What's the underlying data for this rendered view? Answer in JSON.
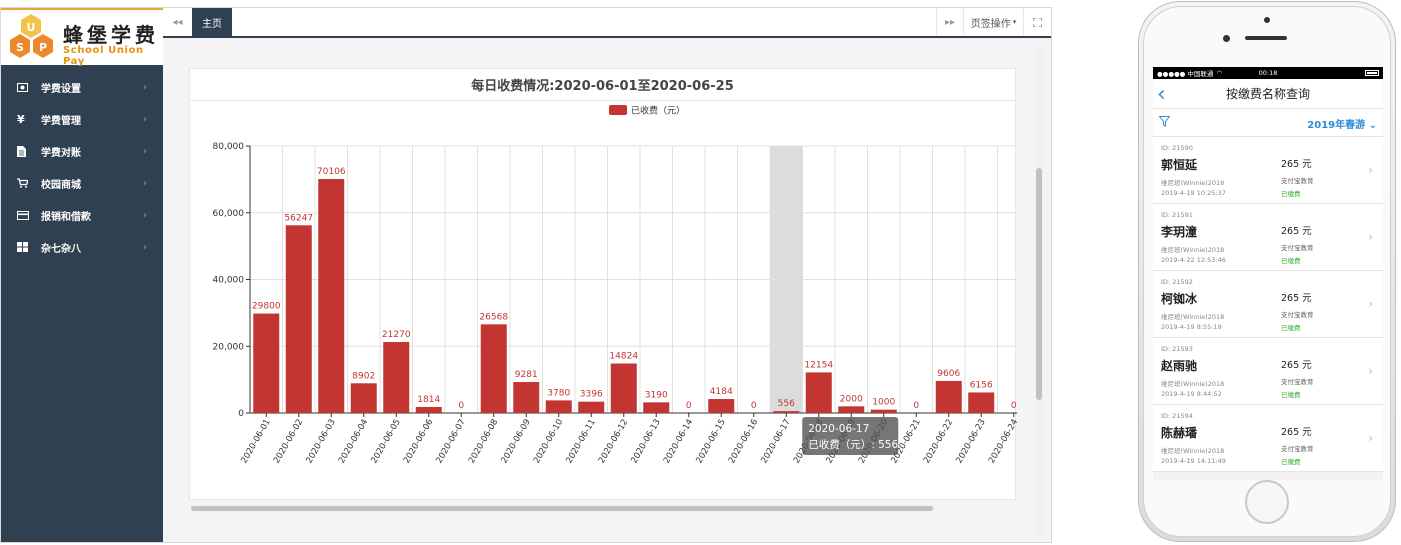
{
  "sidebar": {
    "logo_cn": "蜂堡学费",
    "logo_en": "School Union Pay",
    "items": [
      {
        "label": "学费设置",
        "icon": "money-icon"
      },
      {
        "label": "学费管理",
        "icon": "yen-icon"
      },
      {
        "label": "学费对账",
        "icon": "document-icon"
      },
      {
        "label": "校园商城",
        "icon": "cart-icon"
      },
      {
        "label": "报销和借款",
        "icon": "card-icon"
      },
      {
        "label": "杂七杂八",
        "icon": "grid-icon"
      }
    ]
  },
  "tabbar": {
    "home_tab": "主页",
    "page_ops": "页签操作"
  },
  "chart_data": {
    "type": "bar",
    "title": "每日收费情况:2020-06-01至2020-06-25",
    "legend": "已收费（元）",
    "legend_position": "top-center",
    "color": "#c23531",
    "categories": [
      "2020-06-01",
      "2020-06-02",
      "2020-06-03",
      "2020-06-04",
      "2020-06-05",
      "2020-06-06",
      "2020-06-07",
      "2020-06-08",
      "2020-06-09",
      "2020-06-10",
      "2020-06-11",
      "2020-06-12",
      "2020-06-13",
      "2020-06-14",
      "2020-06-15",
      "2020-06-16",
      "2020-06-17",
      "2020-06-18",
      "2020-06-19",
      "2020-06-20",
      "2020-06-21",
      "2020-06-22",
      "2020-06-23",
      "2020-06-24"
    ],
    "values": [
      29800,
      56247,
      70106,
      8902,
      21270,
      1814,
      0,
      26568,
      9281,
      3780,
      3396,
      14824,
      3190,
      0,
      4184,
      0,
      556,
      12154,
      2000,
      1000,
      0,
      9606,
      6156,
      0
    ],
    "ylim": [
      0,
      80000
    ],
    "yticks": [
      "0",
      "20,000",
      "40,000",
      "60,000",
      "80,000"
    ],
    "grid": true,
    "highlight_index": 16,
    "tooltip": {
      "date": "2020-06-17",
      "text": "已收费（元）: 556"
    }
  },
  "phone": {
    "carrier": "●●●●● 中国联通",
    "time": "00:18",
    "title": "按缴费名称查询",
    "filter_value": "2019年春游",
    "records": [
      {
        "id": "ID: 21590",
        "name": "郭恒延",
        "class": "维尼班(Winnie)2018",
        "time": "2019-4-19 10:25:37",
        "amount": "265 元",
        "pay": "支付宝教育",
        "status": "已缴费"
      },
      {
        "id": "ID: 21591",
        "name": "李玥潼",
        "class": "维尼班(Winnie)2018",
        "time": "2019-4-22 12:53:46",
        "amount": "265 元",
        "pay": "支付宝教育",
        "status": "已缴费"
      },
      {
        "id": "ID: 21592",
        "name": "柯铷冰",
        "class": "维尼班(Winnie)2018",
        "time": "2019-4-19 8:55:19",
        "amount": "265 元",
        "pay": "支付宝教育",
        "status": "已缴费"
      },
      {
        "id": "ID: 21593",
        "name": "赵雨驰",
        "class": "维尼班(Winnie)2018",
        "time": "2019-4-19 8:44:52",
        "amount": "265 元",
        "pay": "支付宝教育",
        "status": "已缴费"
      },
      {
        "id": "ID: 21594",
        "name": "陈赫璠",
        "class": "维尼班(Winnie)2018",
        "time": "2019-4-19 14:11:49",
        "amount": "265 元",
        "pay": "支付宝教育",
        "status": "已缴费"
      }
    ]
  }
}
